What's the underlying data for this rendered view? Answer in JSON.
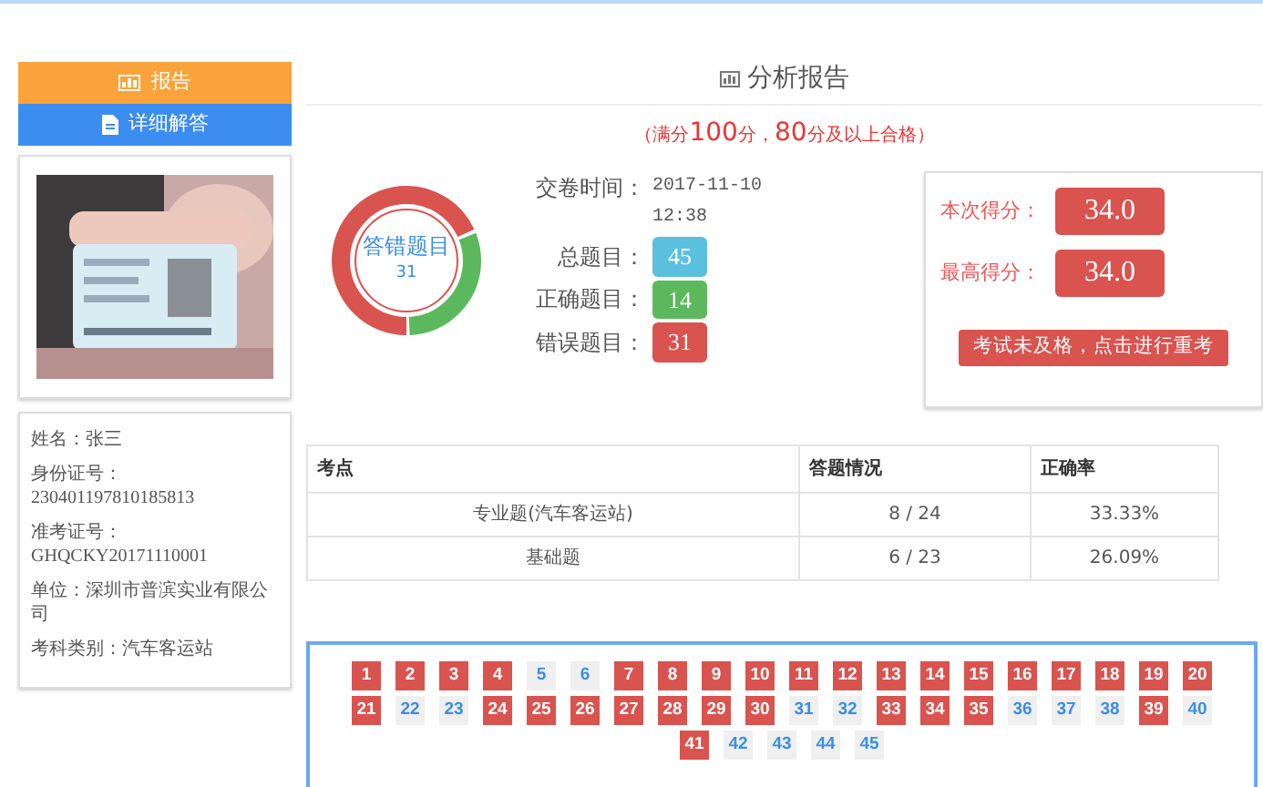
{
  "side_tabs": [
    {
      "label": "报告",
      "selected": true
    },
    {
      "label": "详细解答",
      "selected": false
    }
  ],
  "candidate": [
    {
      "label": "姓名：",
      "value": "张三"
    },
    {
      "label": "身份证号：",
      "value": "230401197810185813"
    },
    {
      "label": "准考证号：",
      "value": "GHQCKY20171110001"
    },
    {
      "label": "单位：",
      "value": "深圳市普滨实业有限公司"
    },
    {
      "label": "考科类别：",
      "value": "汽车客运站"
    }
  ],
  "title": "分析报告",
  "subtitle": [
    {
      "text": "（满分",
      "emphasis": false
    },
    {
      "text": "100",
      "emphasis": true
    },
    {
      "text": "分，",
      "emphasis": false
    },
    {
      "text": "80",
      "emphasis": true
    },
    {
      "text": "分及以上合格）",
      "emphasis": false
    }
  ],
  "donut": {
    "title": "答错题目",
    "count": "31",
    "level": 0.689
  },
  "summary": {
    "time_label": "交卷时间：",
    "date": "2017-11-10",
    "time": "12:38",
    "stats": [
      {
        "label": "总题目：",
        "value": "45",
        "color": "#5bc0de"
      },
      {
        "label": "正确题目：",
        "value": "14",
        "color": "#5cb85c"
      },
      {
        "label": "错误题目：",
        "value": "31",
        "color": "#d9534f"
      }
    ]
  },
  "scores": [
    {
      "label": "本次得分：",
      "value": "34.0"
    },
    {
      "label": "最高得分：",
      "value": "34.0"
    }
  ],
  "retake_button": "考试未及格，点击进行重考",
  "table": {
    "columns": [
      "考点",
      "答题情况",
      "正确率"
    ],
    "rows": [
      [
        "专业题(汽车客运站)",
        "8 / 24",
        "33.33%"
      ],
      [
        "基础题",
        "6 / 23",
        "26.09%"
      ]
    ]
  },
  "answers": [
    {
      "number": "1",
      "correct": false
    },
    {
      "number": "2",
      "correct": false
    },
    {
      "number": "3",
      "correct": false
    },
    {
      "number": "4",
      "correct": false
    },
    {
      "number": "5",
      "correct": true
    },
    {
      "number": "6",
      "correct": true
    },
    {
      "number": "7",
      "correct": false
    },
    {
      "number": "8",
      "correct": false
    },
    {
      "number": "9",
      "correct": false
    },
    {
      "number": "10",
      "correct": false
    },
    {
      "number": "11",
      "correct": false
    },
    {
      "number": "12",
      "correct": false
    },
    {
      "number": "13",
      "correct": false
    },
    {
      "number": "14",
      "correct": false
    },
    {
      "number": "15",
      "correct": false
    },
    {
      "number": "16",
      "correct": false
    },
    {
      "number": "17",
      "correct": false
    },
    {
      "number": "18",
      "correct": false
    },
    {
      "number": "19",
      "correct": false
    },
    {
      "number": "20",
      "correct": false
    },
    {
      "number": "21",
      "correct": false
    },
    {
      "number": "22",
      "correct": true
    },
    {
      "number": "23",
      "correct": true
    },
    {
      "number": "24",
      "correct": false
    },
    {
      "number": "25",
      "correct": false
    },
    {
      "number": "26",
      "correct": false
    },
    {
      "number": "27",
      "correct": false
    },
    {
      "number": "28",
      "correct": false
    },
    {
      "number": "29",
      "correct": false
    },
    {
      "number": "30",
      "correct": false
    },
    {
      "number": "31",
      "correct": true
    },
    {
      "number": "32",
      "correct": true
    },
    {
      "number": "33",
      "correct": false
    },
    {
      "number": "34",
      "correct": false
    },
    {
      "number": "35",
      "correct": false
    },
    {
      "number": "36",
      "correct": true
    },
    {
      "number": "37",
      "correct": true
    },
    {
      "number": "38",
      "correct": true
    },
    {
      "number": "39",
      "correct": false
    },
    {
      "number": "40",
      "correct": true
    },
    {
      "number": "41",
      "correct": false
    },
    {
      "number": "42",
      "correct": true
    },
    {
      "number": "43",
      "correct": true
    },
    {
      "number": "44",
      "correct": true
    },
    {
      "number": "45",
      "correct": true
    }
  ]
}
